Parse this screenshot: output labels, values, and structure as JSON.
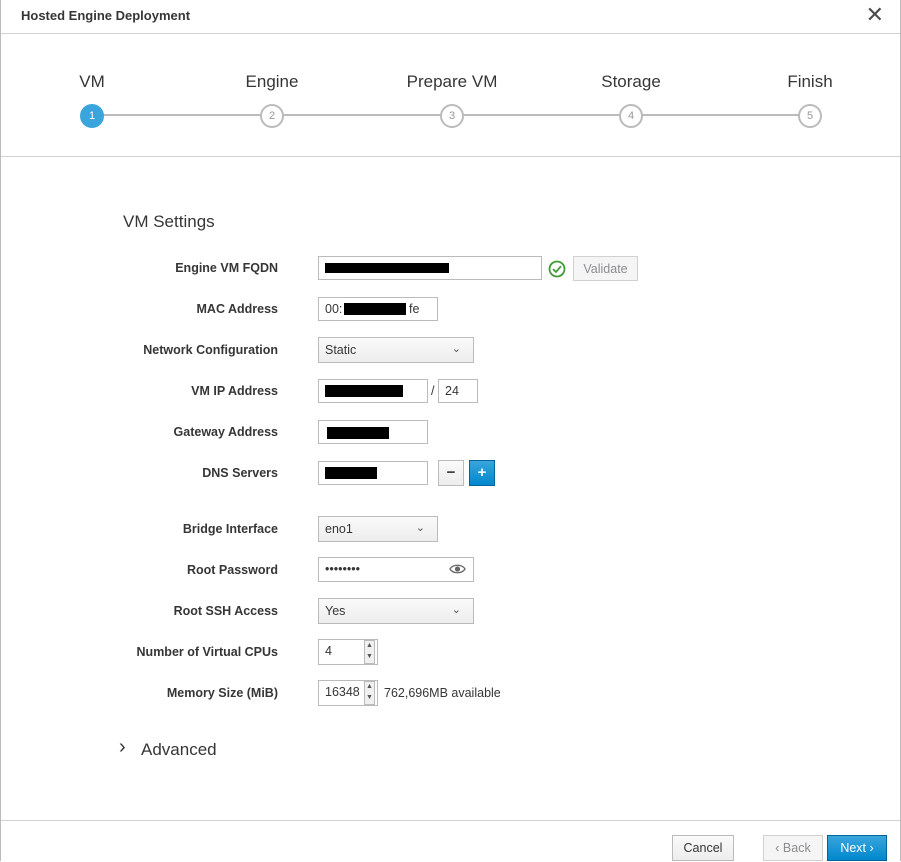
{
  "dialog": {
    "title": "Hosted Engine Deployment"
  },
  "steps": [
    {
      "label": "VM",
      "number": "1",
      "active": true
    },
    {
      "label": "Engine",
      "number": "2",
      "active": false
    },
    {
      "label": "Prepare VM",
      "number": "3",
      "active": false
    },
    {
      "label": "Storage",
      "number": "4",
      "active": false
    },
    {
      "label": "Finish",
      "number": "5",
      "active": false
    }
  ],
  "vm_settings": {
    "section_title": "VM Settings",
    "engine_fqdn": {
      "label": "Engine VM FQDN",
      "validate_label": "Validate"
    },
    "mac_address": {
      "label": "MAC Address",
      "value_prefix": "00:",
      "value_suffix": "fe"
    },
    "network_configuration": {
      "label": "Network Configuration",
      "value": "Static"
    },
    "vm_ip_address": {
      "label": "VM IP Address",
      "slash": "/",
      "prefix": "24"
    },
    "gateway_address": {
      "label": "Gateway Address"
    },
    "dns_servers": {
      "label": "DNS Servers",
      "remove_symbol": "−",
      "add_symbol": "+"
    },
    "bridge_interface": {
      "label": "Bridge Interface",
      "value": "eno1"
    },
    "root_password": {
      "label": "Root Password",
      "value": "••••••••"
    },
    "root_ssh_access": {
      "label": "Root SSH Access",
      "value": "Yes"
    },
    "virtual_cpus": {
      "label": "Number of Virtual CPUs",
      "value": "4"
    },
    "memory_size": {
      "label": "Memory Size (MiB)",
      "value": "16348",
      "available": "762,696MB available"
    },
    "advanced": {
      "label": "Advanced",
      "chevron": "›"
    }
  },
  "footer": {
    "cancel_label": "Cancel",
    "back_label": "‹ Back",
    "next_label": "Next ›"
  },
  "colors": {
    "accent": "#39a5dc",
    "primary_button": "#0088ce",
    "valid_check": "#3f9c35"
  },
  "icons": {
    "close": "close-icon",
    "valid": "check-circle-icon",
    "reveal_password": "eye-icon",
    "dropdown": "chevron-down-icon"
  }
}
